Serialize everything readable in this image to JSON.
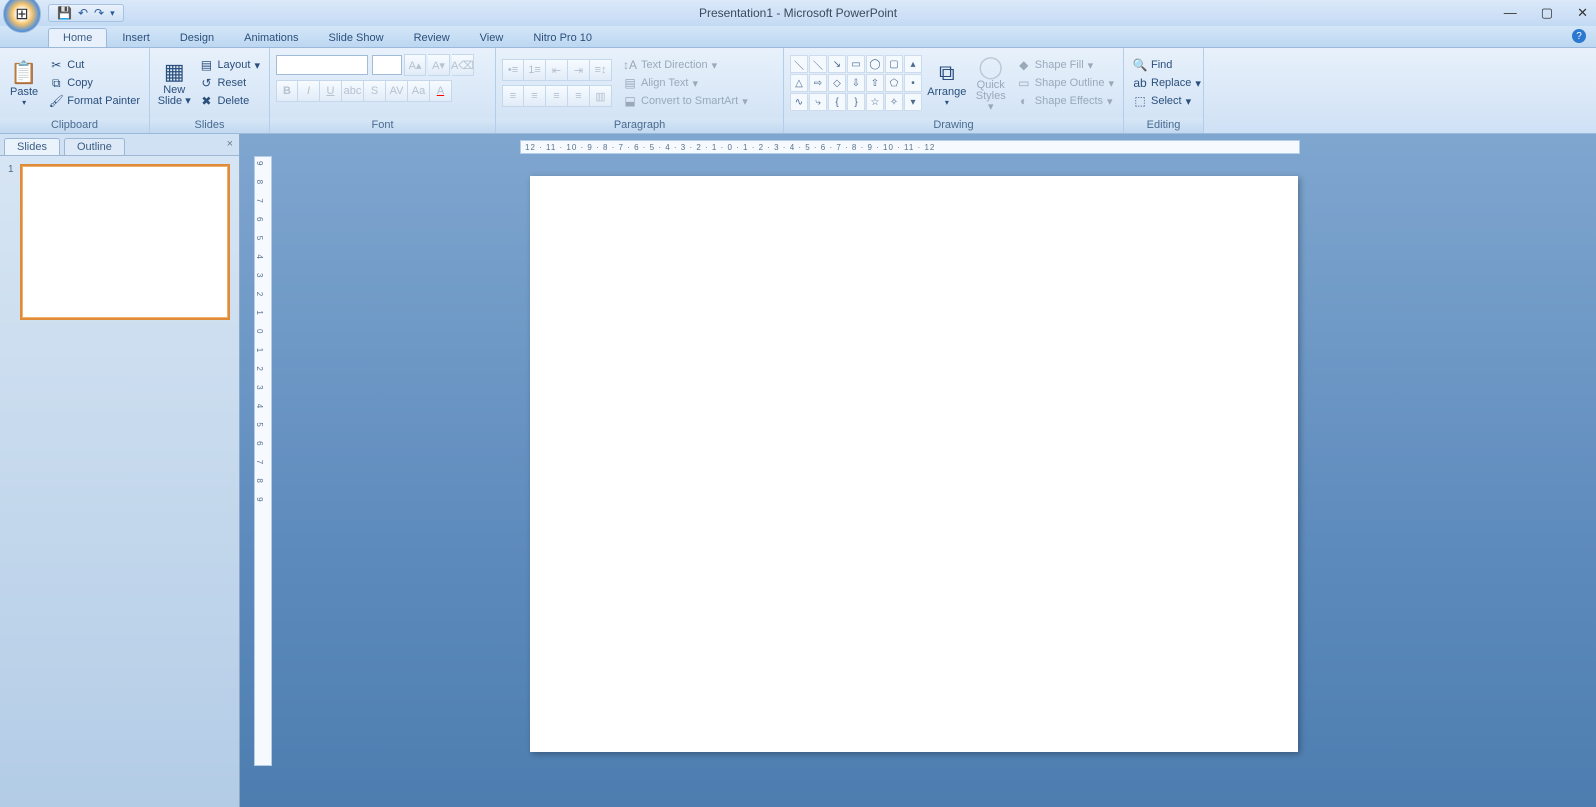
{
  "title": "Presentation1 - Microsoft PowerPoint",
  "tabs": [
    "Home",
    "Insert",
    "Design",
    "Animations",
    "Slide Show",
    "Review",
    "View",
    "Nitro Pro 10"
  ],
  "activeTab": 0,
  "clipboard": {
    "label": "Clipboard",
    "paste": "Paste",
    "cut": "Cut",
    "copy": "Copy",
    "formatPainter": "Format Painter"
  },
  "slides": {
    "label": "Slides",
    "newSlide": "New\nSlide",
    "layout": "Layout",
    "reset": "Reset",
    "delete": "Delete"
  },
  "font": {
    "label": "Font",
    "name": "",
    "size": ""
  },
  "paragraph": {
    "label": "Paragraph",
    "textDirection": "Text Direction",
    "alignText": "Align Text",
    "convertSmartArt": "Convert to SmartArt"
  },
  "drawing": {
    "label": "Drawing",
    "arrange": "Arrange",
    "quickStyles": "Quick\nStyles",
    "shapeFill": "Shape Fill",
    "shapeOutline": "Shape Outline",
    "shapeEffects": "Shape Effects"
  },
  "editing": {
    "label": "Editing",
    "find": "Find",
    "replace": "Replace",
    "select": "Select"
  },
  "panel": {
    "slides": "Slides",
    "outline": "Outline",
    "thumbNum": "1"
  },
  "hRuler": "12 · 11 · 10 · 9 · 8 · 7 · 6 · 5 · 4 · 3 · 2 · 1 · 0 · 1 · 2 · 3 · 4 · 5 · 6 · 7 · 8 · 9 · 10 · 11 · 12",
  "vRuler": "9 8 7 6 5 4 3 2 1 0 1 2 3 4 5 6 7 8 9"
}
